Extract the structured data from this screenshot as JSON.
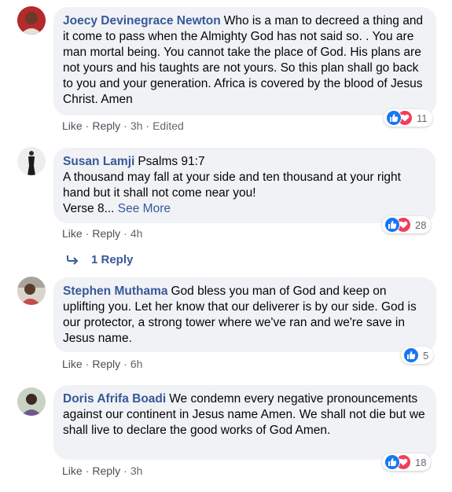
{
  "comments": [
    {
      "author": "Joecy Devinegrace Newton",
      "text": "Who is a man to decreed a thing and it come to pass when the Almighty God has not said so. . You are man mortal being. You cannot take the place of God. His plans are not yours and his taughts are not yours. So this plan shall go back to you and your generation. Africa is covered by the blood of Jesus Christ. Amen",
      "like": "Like",
      "reply": "Reply",
      "time": "3h",
      "edited": "Edited",
      "reactions": "11"
    },
    {
      "author": "Susan Lamji",
      "text": "Psalms 91:7",
      "line2": "A thousand may fall at your side and ten thousand at your right hand but it shall not come near you!",
      "line3": "Verse 8...",
      "see_more": "See More",
      "like": "Like",
      "reply": "Reply",
      "time": "4h",
      "reactions": "28",
      "replies_label": "1 Reply"
    },
    {
      "author": "Stephen Muthama",
      "text": "God bless you man of God and keep on uplifting you. Let her know that our deliverer is by our side. God is our protector, a strong tower where we've ran and we're save in Jesus name.",
      "like": "Like",
      "reply": "Reply",
      "time": "6h",
      "reactions": "5"
    },
    {
      "author": "Doris Afrifa Boadi",
      "text": "We condemn every negative pronouncements against our continent in Jesus name Amen. We shall not die but we shall live to declare the good works of God Amen.",
      "like": "Like",
      "reply": "Reply",
      "time": "3h",
      "reactions": "18"
    }
  ],
  "colors": {
    "author": "#385898",
    "bubble": "#f0f2f5",
    "like_reaction": "#1877f2",
    "love_reaction": "#f33e58"
  }
}
